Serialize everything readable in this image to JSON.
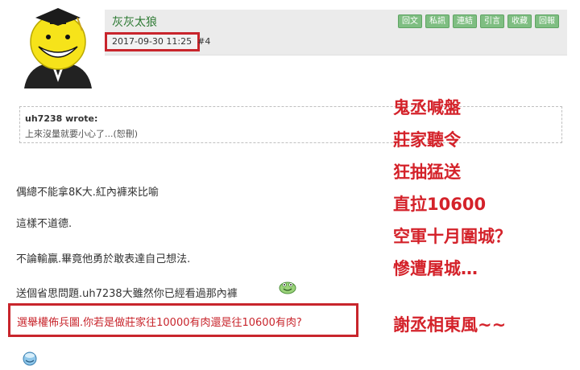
{
  "post": {
    "username": "灰灰太狼",
    "datetime": "2017-09-30 11:25",
    "floor": "#4",
    "actions": [
      "回文",
      "私訊",
      "連結",
      "引言",
      "收藏",
      "回報"
    ]
  },
  "quote": {
    "author": "uh7238 wrote:",
    "text": "上來沒量就要小心了...(恕刪)"
  },
  "body": {
    "lines": [
      "偶總不能拿8K大.紅內褲來比喻",
      "這樣不道德.",
      "不論輸贏.畢竟他勇於敢表達自己想法.",
      "送個省思問題.uh7238大雖然你已經看過那內褲"
    ],
    "highlight": "選舉權佈兵圖.你若是做莊家往10000有肉還是往10600有肉?"
  },
  "overlay": {
    "lines": [
      "鬼丞喊盤",
      "莊家聽令",
      "狂抽猛送",
      "直拉10600",
      "空軍十月圍城？",
      "慘遭屠城…"
    ],
    "signoff": "謝丞相東風~~"
  },
  "icons": {
    "avatar": "koro-sensei-avatar",
    "emoticon_green": "green-smiley-icon",
    "emoticon_blue": "blue-smiley-icon"
  },
  "colors": {
    "accent_red": "#c8252c",
    "username_green": "#2d7a33",
    "button_green": "#7fbe82"
  }
}
